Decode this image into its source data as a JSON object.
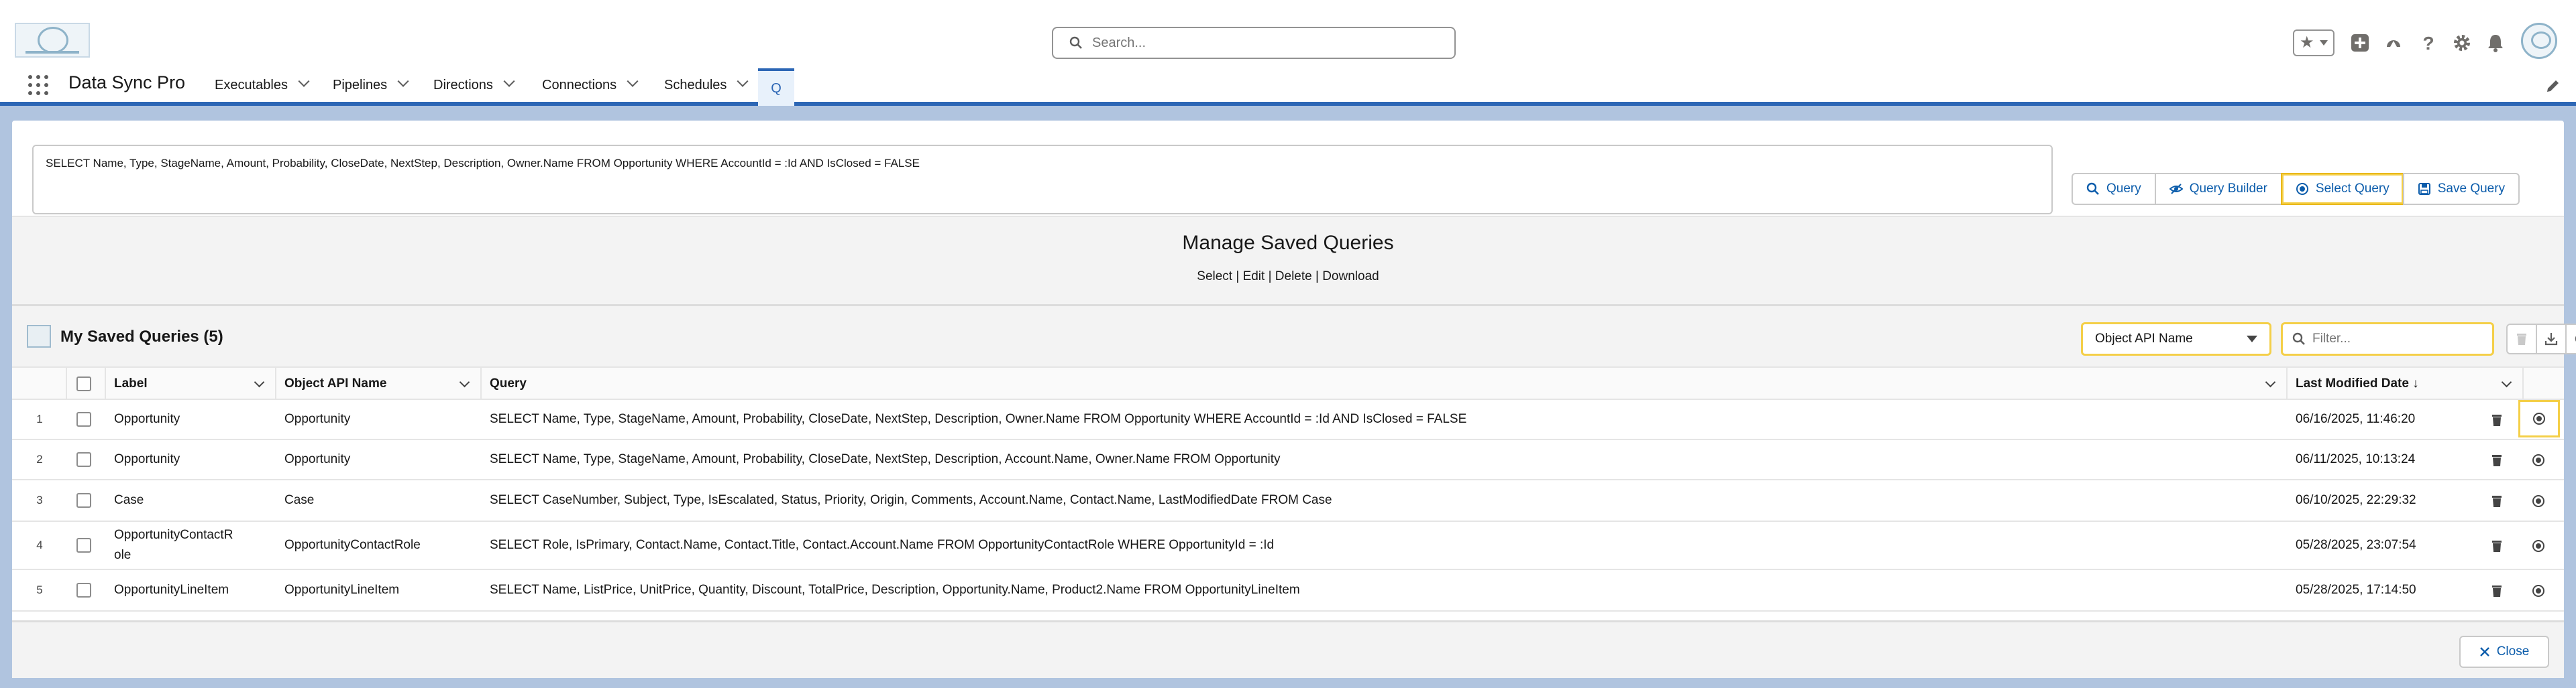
{
  "search": {
    "placeholder": "Search..."
  },
  "app": {
    "name": "Data Sync Pro"
  },
  "nav": {
    "items": [
      {
        "label": "Executables"
      },
      {
        "label": "Pipelines"
      },
      {
        "label": "Directions"
      },
      {
        "label": "Connections"
      },
      {
        "label": "Schedules"
      }
    ],
    "active_tab_label": "Q"
  },
  "query": {
    "text": "SELECT Name, Type, StageName, Amount, Probability, CloseDate, NextStep, Description, Owner.Name FROM Opportunity WHERE AccountId = :Id AND IsClosed = FALSE",
    "buttons": {
      "query": "Query",
      "query_builder": "Query Builder",
      "select_query": "Select Query",
      "save_query": "Save Query"
    }
  },
  "modal": {
    "title": "Manage Saved Queries",
    "links": "Select | Edit | Delete | Download",
    "list_title": "My Saved Queries (5)",
    "object_select": "Object API Name",
    "filter_placeholder": "Filter...",
    "close_label": "Close"
  },
  "table": {
    "columns": {
      "label": "Label",
      "object": "Object API Name",
      "query": "Query",
      "modified": "Last Modified Date ↓"
    },
    "rows": [
      {
        "num": "1",
        "label": "Opportunity",
        "object": "Opportunity",
        "query": "SELECT Name, Type, StageName, Amount, Probability, CloseDate, NextStep, Description, Owner.Name FROM Opportunity WHERE AccountId = :Id AND IsClosed = FALSE",
        "modified": "06/16/2025, 11:46:20"
      },
      {
        "num": "2",
        "label": "Opportunity",
        "object": "Opportunity",
        "query": "SELECT Name, Type, StageName, Amount, Probability, CloseDate, NextStep, Description, Account.Name, Owner.Name FROM Opportunity",
        "modified": "06/11/2025, 10:13:24"
      },
      {
        "num": "3",
        "label": "Case",
        "object": "Case",
        "query": "SELECT CaseNumber, Subject, Type, IsEscalated, Status, Priority, Origin, Comments, Account.Name, Contact.Name, LastModifiedDate FROM Case",
        "modified": "06/10/2025, 22:29:32"
      },
      {
        "num": "4",
        "label": "OpportunityContactR\nole",
        "object": "OpportunityContactRole",
        "query": "SELECT Role, IsPrimary, Contact.Name, Contact.Title, Contact.Account.Name FROM OpportunityContactRole WHERE OpportunityId = :Id",
        "modified": "05/28/2025, 23:07:54"
      },
      {
        "num": "5",
        "label": "OpportunityLineItem",
        "object": "OpportunityLineItem",
        "query": "SELECT Name, ListPrice, UnitPrice, Quantity, Discount, TotalPrice, Description, Opportunity.Name, Product2.Name FROM OpportunityLineItem",
        "modified": "05/28/2025, 17:14:50"
      }
    ]
  }
}
